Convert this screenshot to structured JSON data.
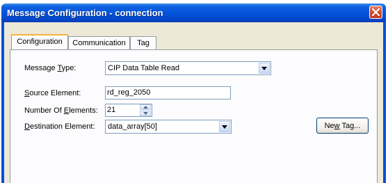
{
  "window": {
    "title": "Message Configuration - connection"
  },
  "tabs": [
    {
      "label": "Configuration",
      "active": true
    },
    {
      "label": "Communication",
      "active": false
    },
    {
      "label": "Tag",
      "active": false
    }
  ],
  "form": {
    "message_type": {
      "label_pre": "Message ",
      "label_key": "T",
      "label_post": "ype:",
      "value": "CIP Data Table Read"
    },
    "source_element": {
      "label_key": "S",
      "label_post": "ource Element:",
      "value": "rd_reg_2050"
    },
    "number_of_elements": {
      "label_pre": "Number Of ",
      "label_key": "E",
      "label_post": "lements:",
      "value": "21"
    },
    "destination_element": {
      "label_key": "D",
      "label_post": "estination Element:",
      "value": "data_array[50]"
    },
    "new_tag_button": {
      "label_pre": "Ne",
      "label_key": "w",
      "label_post": " Tag..."
    }
  },
  "icons": {
    "close": "close-icon",
    "dropdown": "chevron-down-icon",
    "spin_up": "arrow-up-icon",
    "spin_down": "arrow-down-icon"
  },
  "colors": {
    "titlebar": "#0355dc",
    "window_bg": "#ece9d8",
    "close_button": "#d5492b",
    "active_tab_accent": "#f5b33a"
  }
}
